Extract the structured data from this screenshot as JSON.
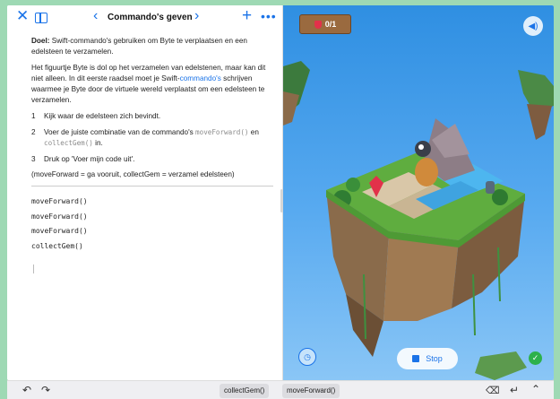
{
  "toolbar": {
    "title": "Commando's geven",
    "close_icon": "close-icon",
    "sidebar_icon": "sidebar-icon",
    "prev_icon": "chevron-left-icon",
    "next_icon": "chevron-right-icon",
    "add_icon": "plus-icon",
    "more_icon": "more-icon"
  },
  "instructions": {
    "goal_label": "Doel:",
    "goal_text": " Swift-commando's gebruiken om Byte te verplaatsen en een edelsteen te verzamelen.",
    "intro_part1": "Het figuurtje Byte is dol op het verzamelen van edelstenen, maar kan dit niet alleen. In dit eerste raadsel moet je Swift-",
    "intro_link": "commando's",
    "intro_part2": " schrijven waarmee je Byte door de virtuele wereld verplaatst om een edelsteen te verzamelen.",
    "steps": [
      {
        "num": "1",
        "text": "Kijk waar de edelsteen zich bevindt."
      },
      {
        "num": "2",
        "text_a": "Voer de juiste combinatie van de commando's ",
        "code_a": "moveForward()",
        "text_b": " en ",
        "code_b": "collectGem()",
        "text_c": " in."
      },
      {
        "num": "3",
        "text": "Druk op 'Voer mijn code uit'."
      }
    ],
    "legend": "(moveForward = ga vooruit, collectGem = verzamel edelsteen)"
  },
  "code": {
    "lines": [
      "moveForward()",
      "moveForward()",
      "moveForward()",
      "collectGem()"
    ]
  },
  "scene": {
    "gem_counter": "0/1",
    "stop_label": "Stop",
    "sound_icon": "speaker-icon",
    "speed_icon": "speed-icon",
    "check_icon": "checkmark-icon"
  },
  "keyboard": {
    "suggestions": [
      "collectGem()",
      "moveForward()"
    ]
  },
  "colors": {
    "accent": "#1a73e8",
    "outer_background": "#9ed9b4",
    "success": "#2db14b",
    "sky": "#4ba3ee"
  }
}
